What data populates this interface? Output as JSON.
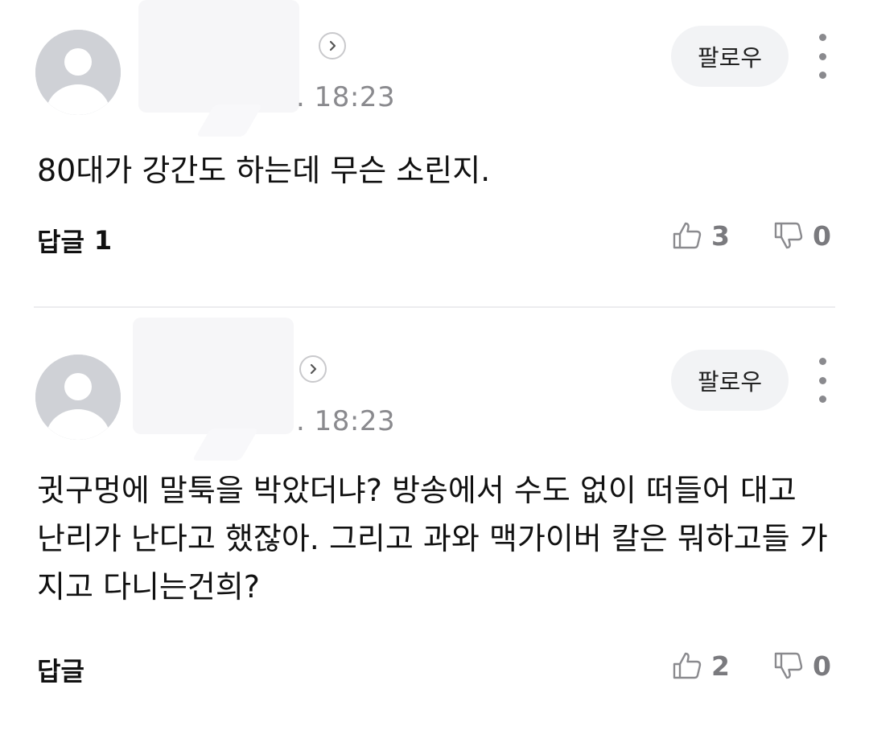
{
  "comments": [
    {
      "time": ". 18:23",
      "follow_label": "팔로우",
      "text": "80대가 강간도 하는데 무슨 소린지.",
      "reply_label": "답글",
      "reply_count": "1",
      "likes": "3",
      "dislikes": "0"
    },
    {
      "time": ". 18:23",
      "follow_label": "팔로우",
      "text": "귓구멍에 말툭을 박았더냐? 방송에서 수도 없이 떠들어 대고 난리가 난다고 했잖아. 그리고 과와 맥가이버 칼은 뭐하고들 가지고 다니는건희?",
      "reply_label": "답글",
      "reply_count": "",
      "likes": "2",
      "dislikes": "0"
    }
  ],
  "icons": {
    "avatar": "default-user-avatar-icon",
    "profile": "chevron-right-icon",
    "more": "vertical-ellipsis-icon",
    "like": "thumbs-up-icon",
    "dislike": "thumbs-down-icon"
  },
  "colors": {
    "avatar_bg": "#cfd1d6",
    "follow_bg": "#f2f3f5",
    "muted_text": "#8a8a8e",
    "divider": "#ececef"
  }
}
